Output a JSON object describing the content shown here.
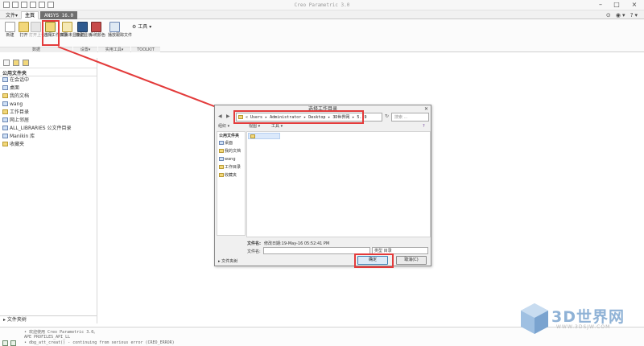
{
  "app": {
    "title": "Creo Parametric 3.0",
    "tabs": [
      "文件▾",
      "主页",
      "ANSYS 16.0"
    ]
  },
  "ribbon": {
    "buttons": [
      "新建",
      "打开",
      "打开上一会话",
      "选择工作目录",
      "拭除未显示的",
      "模型显示",
      "系统颜色",
      "播放跟踪文件"
    ],
    "tools_label": "工具",
    "groups": [
      "数据",
      "设置▾",
      "实用工具▾",
      "TOOLKIT"
    ]
  },
  "left_panel": {
    "header": "公用文件夹",
    "items": [
      "在会话中",
      "桌面",
      "我的文档",
      "wang",
      "工作目录",
      "网上邻居",
      "ALL_LIBRARIES 公文件目录",
      "Manikin 库",
      "收藏夹"
    ],
    "bottom": "文件夹树"
  },
  "dialog": {
    "title": "选择工作目录",
    "address": "« Users ▸ Administrator ▸ Desktop ▸ 3D世界网 ▸ 5.19",
    "search_placeholder": "搜索 ...",
    "toolbar": [
      "组织 ▾",
      "视图 ▾",
      "工具 ▾"
    ],
    "left_header": "公用文件夹",
    "left_items": [
      "桌面",
      "我的文档",
      "wang",
      "工作目录",
      "收藏夹"
    ],
    "info_label": "文件名:",
    "info_value": "修改日期:19-May-16 05:52:41 PM",
    "filename_label": "文件名:",
    "type_value": "类型 目录",
    "folder_tree": "文件夹树",
    "ok": "确定",
    "cancel": "取消(C)"
  },
  "status": {
    "messages": [
      "• 欢迎使用 Creo Parametric 3.0。",
      "APE PROFILES_API_LL",
      "• dbg_att_creat() - continuing from serious error (CREO_ERROR)"
    ]
  },
  "watermark": {
    "brand": "3D世界网",
    "url": "WWW.3DSJW.COM"
  },
  "colors": {
    "annotation": "#e33b3b",
    "brand": "#8fb2d6"
  }
}
